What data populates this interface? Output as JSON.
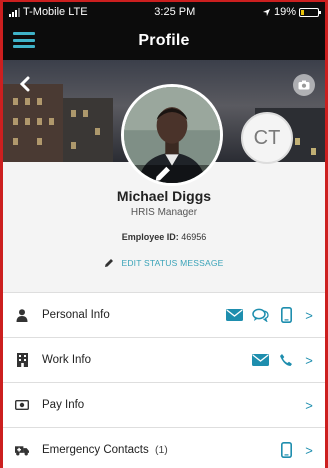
{
  "status_bar": {
    "carrier": "T-Mobile LTE",
    "time": "3:25 PM",
    "battery": "19%",
    "battery_level": 0.19
  },
  "nav": {
    "title": "Profile"
  },
  "profile": {
    "avatar_edit_label": "Edit",
    "initials": "CT",
    "name": "Michael Diggs",
    "job_title": "HRIS Manager",
    "employee_id_label": "Employee ID:",
    "employee_id": "46956",
    "edit_status_label": "EDIT STATUS MESSAGE"
  },
  "sections": [
    {
      "label": "Personal Info",
      "icon": "person-icon",
      "actions": [
        "email-icon",
        "chat-icon",
        "phone-icon"
      ]
    },
    {
      "label": "Work Info",
      "icon": "building-icon",
      "actions": [
        "email-icon",
        "call-icon"
      ]
    },
    {
      "label": "Pay Info",
      "icon": "money-icon",
      "actions": []
    },
    {
      "label": "Emergency Contacts",
      "count": "(1)",
      "icon": "ambulance-icon",
      "actions": [
        "phone-icon"
      ]
    }
  ],
  "colors": {
    "accent": "#1e8eae",
    "link": "#3aa3b8",
    "menu": "#3fb3c8",
    "frame": "#cc1f1f"
  }
}
